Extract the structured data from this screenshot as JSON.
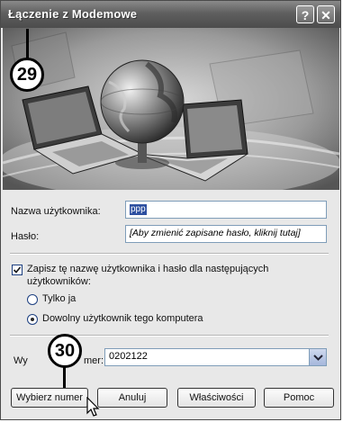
{
  "title": "Łączenie z Modemowe",
  "window_buttons": {
    "help": "?",
    "close": "✕"
  },
  "form": {
    "username_label": "Nazwa użytkownika:",
    "username_value": "ppp",
    "password_label": "Hasło:",
    "password_placeholder": "[Aby zmienić zapisane hasło, kliknij tutaj]",
    "save_checkbox_line1": "Zapisz tę nazwę użytkownika i hasło dla następujących",
    "save_checkbox_line2": "użytkowników:",
    "save_checked": true,
    "radio_only_me": "Tylko ja",
    "radio_anyone": "Dowolny użytkownik tego komputera",
    "selected_radio": "anyone",
    "dial_label_left": "Wy",
    "dial_label_right": "mer:",
    "dial_value": "0202122"
  },
  "buttons": {
    "dial": "Wybierz numer",
    "cancel": "Anuluj",
    "properties": "Właściwości",
    "help": "Pomoc"
  },
  "callouts": {
    "top": "29",
    "bottom": "30"
  }
}
